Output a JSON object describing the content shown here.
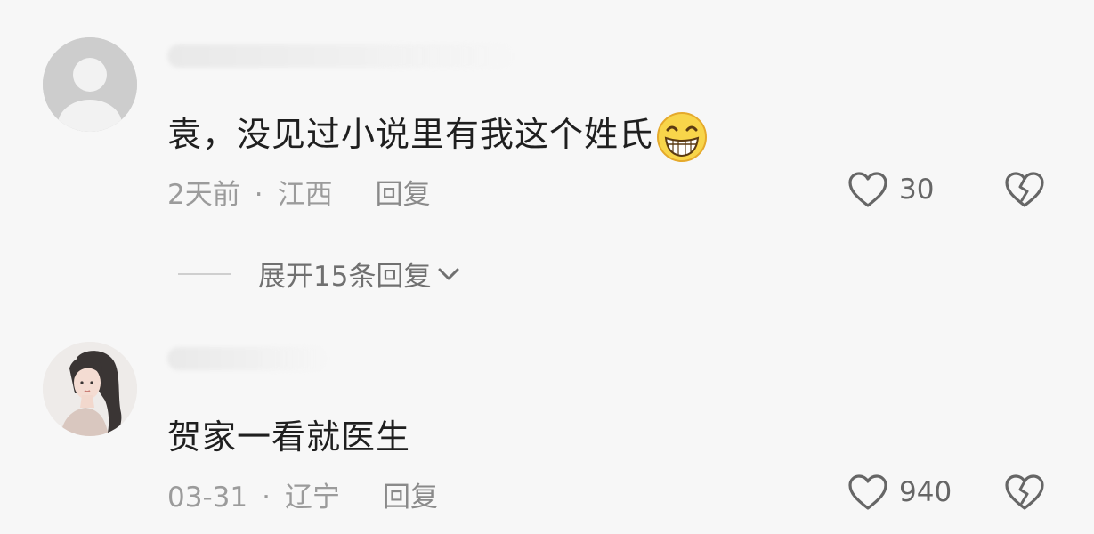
{
  "comments": [
    {
      "text": "袁，没见过小说里有我这个姓氏",
      "emoji": "grinning-face-emoji",
      "time": "2天前",
      "location": "江西",
      "reply_label": "回复",
      "likes": "30",
      "expand_label": "展开15条回复"
    },
    {
      "text": "贺家一看就医生",
      "time": "03-31",
      "location": "辽宁",
      "reply_label": "回复",
      "likes": "940"
    }
  ],
  "separator": "·"
}
